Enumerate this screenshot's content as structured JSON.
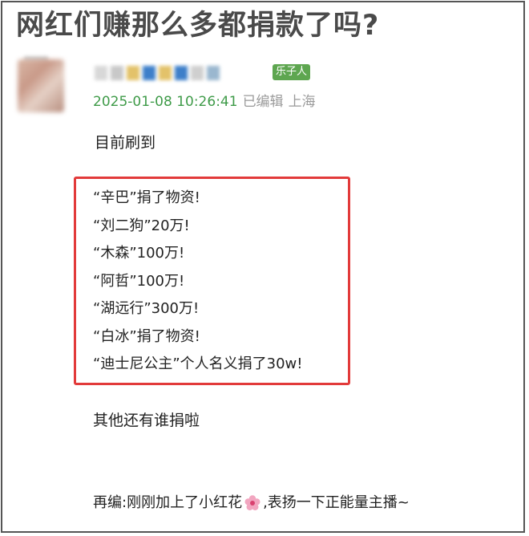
{
  "post": {
    "title": "网红们赚那么多都捐款了吗?",
    "level_badge": "乐子人",
    "timestamp": "2025-01-08 10:26:41",
    "edited_label": "已编辑",
    "location": "上海",
    "lead_text": "目前刷到",
    "donations": [
      "“辛巴”捐了物资!",
      "“刘二狗”20万!",
      "“木森”100万!",
      "“阿哲”100万!",
      "“湖远行”300万!",
      "“白冰”捐了物资!",
      "“迪士尼公主”个人名义捐了30w!"
    ],
    "followup_text": "其他还有谁捐啦",
    "edit_note_before": "再编:刚刚加上了小红花",
    "edit_note_after": ",表扬一下正能量主播~"
  },
  "icons": {
    "flower": "flower-icon"
  },
  "colors": {
    "timestamp": "#3f9b49",
    "badge": "#5ea650",
    "highlight_border": "#e23a3a",
    "title": "#4a4a4a"
  }
}
